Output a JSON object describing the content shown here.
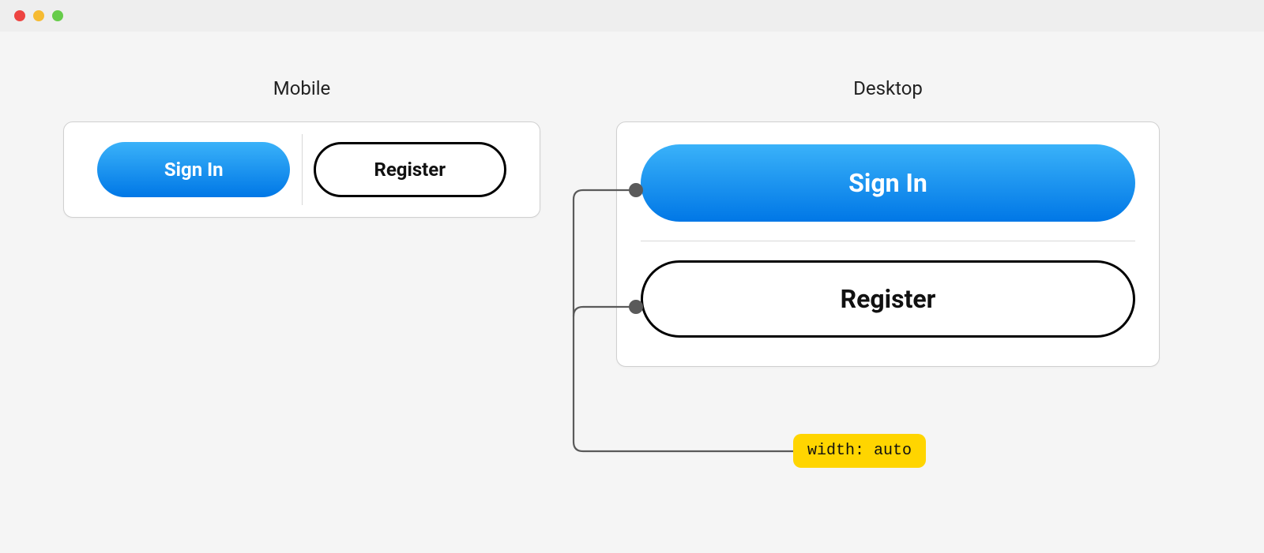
{
  "headings": {
    "mobile": "Mobile",
    "desktop": "Desktop"
  },
  "buttons": {
    "sign_in": "Sign In",
    "register": "Register"
  },
  "annotation": {
    "label": "width: auto"
  }
}
